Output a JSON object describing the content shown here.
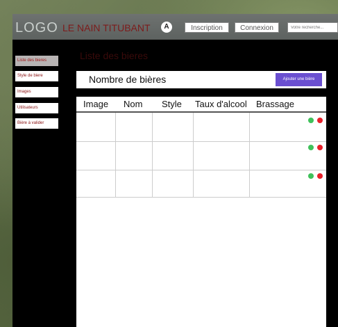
{
  "header": {
    "logo": "LOGO",
    "site_name": "LE NAIN TITUBANT",
    "avatar_letter": "A",
    "register_label": "Inscription",
    "login_label": "Connexion",
    "search_placeholder": "Votre recherche..."
  },
  "sidebar": {
    "items": [
      {
        "label": "Liste des bieres"
      },
      {
        "label": "Style de biere"
      },
      {
        "label": "Images"
      },
      {
        "label": "Utilisateurs"
      },
      {
        "label": "Bière à valider"
      }
    ]
  },
  "main": {
    "title": "Liste des bieres",
    "count_label": "Nombre de bières",
    "add_button": "Ajouter une bière",
    "table": {
      "headers": [
        "Image",
        "Nom",
        "Style",
        "Taux d'alcool",
        "Brassage"
      ],
      "row_count": 3
    }
  },
  "colors": {
    "accent": "#6a4fd0",
    "approve": "#3fc15a",
    "reject": "#e8202a"
  }
}
